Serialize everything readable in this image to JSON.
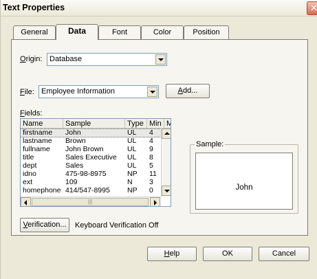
{
  "window": {
    "title": "Text Properties",
    "close_glyph": "✕"
  },
  "tabs": [
    {
      "label": "General"
    },
    {
      "label": "Data",
      "active": true
    },
    {
      "label": "Font"
    },
    {
      "label": "Color"
    },
    {
      "label": "Position"
    }
  ],
  "origin": {
    "label_prefix": "O",
    "label_rest": "rigin:",
    "value": "Database"
  },
  "file": {
    "label_prefix": "F",
    "label_rest": "ile:",
    "value": "Employee Information",
    "add_prefix": "A",
    "add_rest": "dd..."
  },
  "fields": {
    "label_prefix": "F",
    "label_rest": "ields:",
    "columns": [
      "Name",
      "Sample",
      "Type",
      "Min",
      "Ma"
    ],
    "rows": [
      {
        "name": "firstname",
        "sample": "John",
        "type": "UL",
        "min": "4"
      },
      {
        "name": "lastname",
        "sample": "Brown",
        "type": "UL",
        "min": "4"
      },
      {
        "name": "fullname",
        "sample": "John Brown",
        "type": "UL",
        "min": "9"
      },
      {
        "name": "title",
        "sample": "Sales Executive",
        "type": "UL",
        "min": "8"
      },
      {
        "name": "dept",
        "sample": "Sales",
        "type": "UL",
        "min": "5"
      },
      {
        "name": "idno",
        "sample": "475-98-8975",
        "type": "NP",
        "min": "11"
      },
      {
        "name": "ext",
        "sample": "109",
        "type": "N",
        "min": "3"
      },
      {
        "name": "homephone",
        "sample": "414/547-8995",
        "type": "NP",
        "min": "0"
      }
    ],
    "selected_index": 0,
    "hscroll_grip": "|||"
  },
  "verification": {
    "button_prefix": "V",
    "button_rest": "erification...",
    "status": "Keyboard Verification Off"
  },
  "sample": {
    "label": "Sample:",
    "value": "John"
  },
  "footer": {
    "help_prefix": "H",
    "help_rest": "elp",
    "ok": "OK",
    "cancel": "Cancel"
  }
}
